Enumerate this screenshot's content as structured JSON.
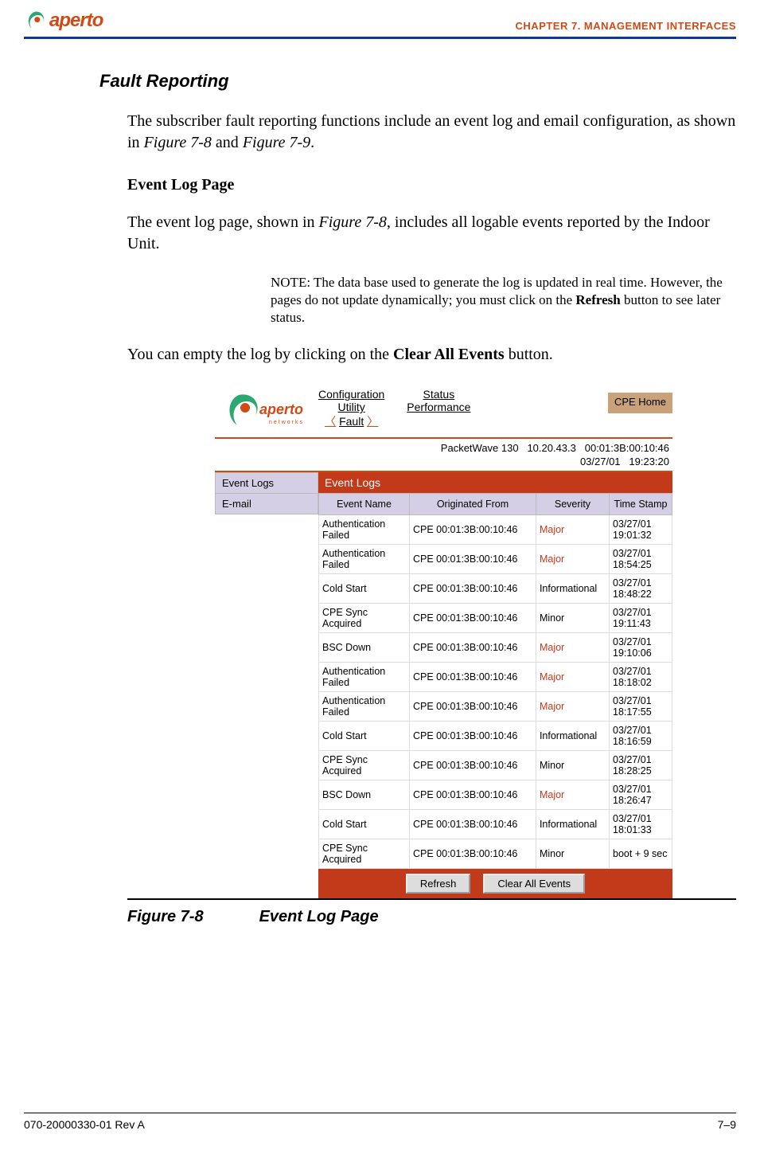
{
  "header": {
    "logo_text": "aperto",
    "chapter": "CHAPTER 7.  MANAGEMENT INTERFACES"
  },
  "section": {
    "h3": "Fault Reporting",
    "p1a": "The subscriber fault reporting functions include an event log and email configuration, as shown in ",
    "p1b": "Figure 7-8",
    "p1c": " and ",
    "p1d": "Figure 7-9",
    "p1e": ".",
    "h4": "Event Log Page",
    "p2a": "The event log page, shown in ",
    "p2b": "Figure 7-8",
    "p2c": ", includes all logable events reported by the Indoor Unit.",
    "note_a": "NOTE:  The data base used to generate the log is updated in real time. However, the pages do not update dynamically; you must click on the ",
    "note_b": "Refresh",
    "note_c": " button to see later status.",
    "p3a": "You can empty the log by clicking on the ",
    "p3b": "Clear All Events",
    "p3c": " button."
  },
  "figure": {
    "tabs": {
      "col1": {
        "a": "Configuration",
        "b": "Utility",
        "c": "Fault"
      },
      "col2": {
        "a": "Status",
        "b": "Performance"
      },
      "cpe_home": "CPE Home"
    },
    "device": {
      "model": "PacketWave 130",
      "ip": "10.20.43.3",
      "mac": "00:01:3B:00:10:46",
      "date": "03/27/01",
      "time": "19:23:20"
    },
    "sidebar": {
      "event_logs": "Event Logs",
      "email": "E-mail"
    },
    "main_title": "Event Logs",
    "columns": {
      "c1": "Event Name",
      "c2": "Originated From",
      "c3": "Severity",
      "c4": "Time Stamp"
    },
    "rows": [
      {
        "name": "Authentication Failed",
        "from": "CPE 00:01:3B:00:10:46",
        "sev": "Major",
        "sev_major": true,
        "ts": "03/27/01 19:01:32"
      },
      {
        "name": "Authentication Failed",
        "from": "CPE 00:01:3B:00:10:46",
        "sev": "Major",
        "sev_major": true,
        "ts": "03/27/01 18:54:25"
      },
      {
        "name": "Cold Start",
        "from": "CPE 00:01:3B:00:10:46",
        "sev": "Informational",
        "sev_major": false,
        "ts": "03/27/01 18:48:22"
      },
      {
        "name": "CPE Sync Acquired",
        "from": "CPE 00:01:3B:00:10:46",
        "sev": "Minor",
        "sev_major": false,
        "ts": "03/27/01 19:11:43"
      },
      {
        "name": "BSC Down",
        "from": "CPE 00:01:3B:00:10:46",
        "sev": "Major",
        "sev_major": true,
        "ts": "03/27/01 19:10:06"
      },
      {
        "name": "Authentication Failed",
        "from": "CPE 00:01:3B:00:10:46",
        "sev": "Major",
        "sev_major": true,
        "ts": "03/27/01 18:18:02"
      },
      {
        "name": "Authentication Failed",
        "from": "CPE 00:01:3B:00:10:46",
        "sev": "Major",
        "sev_major": true,
        "ts": "03/27/01 18:17:55"
      },
      {
        "name": "Cold Start",
        "from": "CPE 00:01:3B:00:10:46",
        "sev": "Informational",
        "sev_major": false,
        "ts": "03/27/01 18:16:59"
      },
      {
        "name": "CPE Sync Acquired",
        "from": "CPE 00:01:3B:00:10:46",
        "sev": "Minor",
        "sev_major": false,
        "ts": "03/27/01 18:28:25"
      },
      {
        "name": "BSC Down",
        "from": "CPE 00:01:3B:00:10:46",
        "sev": "Major",
        "sev_major": true,
        "ts": "03/27/01 18:26:47"
      },
      {
        "name": "Cold Start",
        "from": "CPE 00:01:3B:00:10:46",
        "sev": "Informational",
        "sev_major": false,
        "ts": "03/27/01 18:01:33"
      },
      {
        "name": "CPE Sync Acquired",
        "from": "CPE 00:01:3B:00:10:46",
        "sev": "Minor",
        "sev_major": false,
        "ts": "boot + 9 sec"
      }
    ],
    "buttons": {
      "refresh": "Refresh",
      "clear": "Clear All Events"
    },
    "caption_a": "Figure 7-8",
    "caption_b": "Event Log Page"
  },
  "footer": {
    "left": "070-20000330-01 Rev A",
    "right": "7–9"
  }
}
